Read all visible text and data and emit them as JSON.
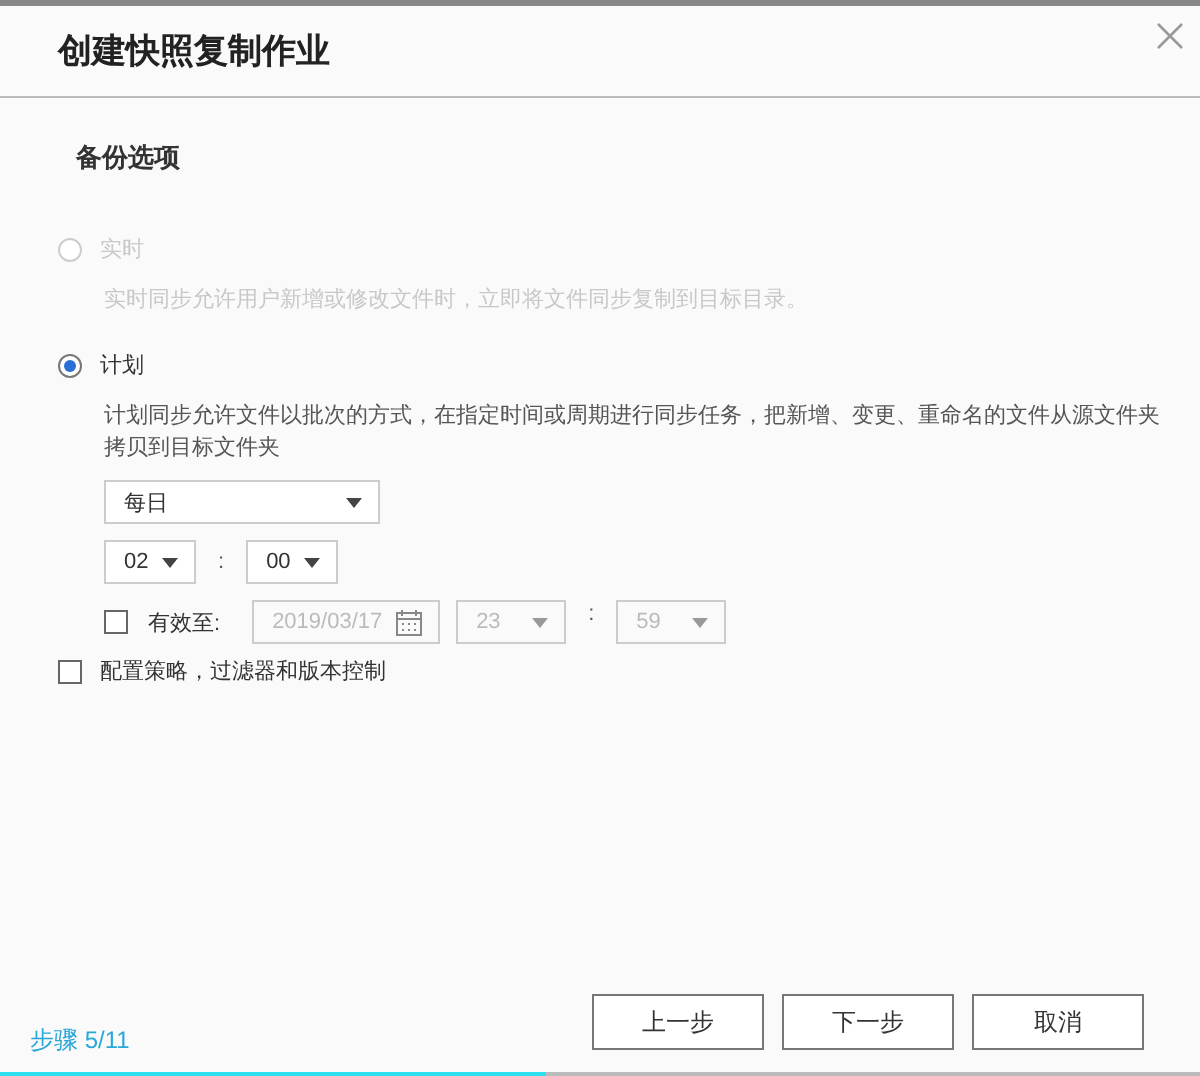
{
  "window": {
    "title": "创建快照复制作业"
  },
  "section": {
    "title": "备份选项"
  },
  "modes": [
    {
      "label": "实时",
      "description": "实时同步允许用户新增或修改文件时，立即将文件同步复制到目标目录。",
      "selected": false,
      "disabled": true
    },
    {
      "label": "计划",
      "description": "计划同步允许文件以批次的方式，在指定时间或周期进行同步任务，把新增、变更、重命名的文件从源文件夹拷贝到目标文件夹",
      "selected": true,
      "disabled": false
    }
  ],
  "schedule": {
    "frequency": "每日",
    "hour": "02",
    "separator": ":",
    "minute": "00",
    "expiry": {
      "checked": false,
      "label": "有效至:",
      "date": "2019/03/17",
      "hour": "23",
      "separator": ":",
      "minute": "59",
      "disabled": true
    }
  },
  "policy": {
    "label": "配置策略，过滤器和版本控制",
    "checked": false
  },
  "footer": {
    "step": "步骤 5/11",
    "progress": {
      "level": 0.455
    },
    "buttons": [
      "上一步",
      "下一步",
      "取消"
    ]
  }
}
